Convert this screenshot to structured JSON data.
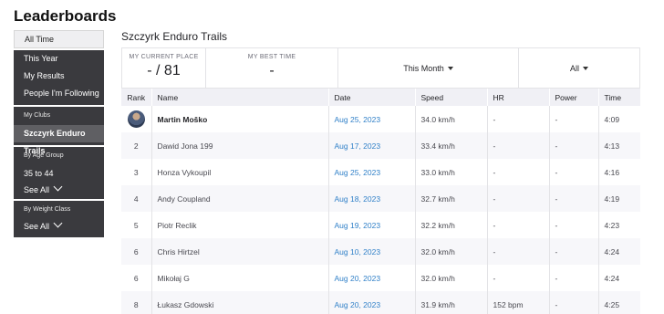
{
  "page": {
    "title": "Leaderboards"
  },
  "sidebar": {
    "all_time": "All Time",
    "items": [
      "This Year",
      "My Results",
      "People I'm Following"
    ],
    "clubs_header": "My Clubs",
    "club_active": "Szczyrk Enduro Trails",
    "age_header": "By Age Group",
    "age_value": "35 to 44",
    "age_see_all": "See All",
    "weight_header": "By Weight Class",
    "weight_see_all": "See All"
  },
  "main": {
    "segment_name": "Szczyrk Enduro Trails",
    "current_place_label": "MY CURRENT PLACE",
    "current_place_value": "- / 81",
    "best_time_label": "MY BEST TIME",
    "best_time_value": "-",
    "filter_time": "This Month",
    "filter_scope": "All"
  },
  "table": {
    "headers": [
      "Rank",
      "Name",
      "Date",
      "Speed",
      "HR",
      "Power",
      "Time"
    ],
    "rows": [
      {
        "rank": "",
        "name": "Martin Moško",
        "date": "Aug 25, 2023",
        "speed": "34.0 km/h",
        "hr": "-",
        "power": "-",
        "time": "4:09"
      },
      {
        "rank": "2",
        "name": "Dawid Jona 199",
        "date": "Aug 17, 2023",
        "speed": "33.4 km/h",
        "hr": "-",
        "power": "-",
        "time": "4:13"
      },
      {
        "rank": "3",
        "name": "Honza Vykoupil",
        "date": "Aug 25, 2023",
        "speed": "33.0 km/h",
        "hr": "-",
        "power": "-",
        "time": "4:16"
      },
      {
        "rank": "4",
        "name": "Andy Coupland",
        "date": "Aug 18, 2023",
        "speed": "32.7 km/h",
        "hr": "-",
        "power": "-",
        "time": "4:19"
      },
      {
        "rank": "5",
        "name": "Piotr Reclik",
        "date": "Aug 19, 2023",
        "speed": "32.2 km/h",
        "hr": "-",
        "power": "-",
        "time": "4:23"
      },
      {
        "rank": "6",
        "name": "Chris Hirtzel",
        "date": "Aug 10, 2023",
        "speed": "32.0 km/h",
        "hr": "-",
        "power": "-",
        "time": "4:24"
      },
      {
        "rank": "6",
        "name": "Mikołaj G",
        "date": "Aug 20, 2023",
        "speed": "32.0 km/h",
        "hr": "-",
        "power": "-",
        "time": "4:24"
      },
      {
        "rank": "8",
        "name": "Łukasz Gdowski",
        "date": "Aug 20, 2023",
        "speed": "31.9 km/h",
        "hr": "152 bpm",
        "power": "-",
        "time": "4:25"
      }
    ]
  },
  "colors": {
    "sidebar_bg": "#3a3a3e",
    "link": "#3080c8",
    "header_bg": "#f0f0f5"
  }
}
